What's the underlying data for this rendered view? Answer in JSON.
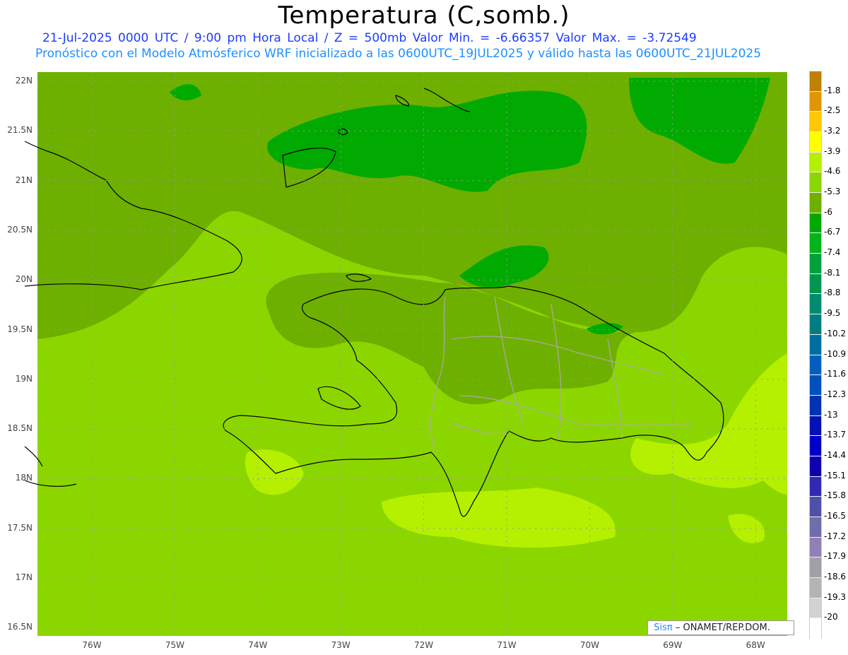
{
  "title": "Temperatura (C,somb.)",
  "subtitle1": "21-Jul-2025   0000 UTC / 9:00 pm Hora Local / Z = 500mb  Valor Min. = -6.66357  Valor Max. = -3.72549",
  "subtitle2": "Pronóstico con el Modelo Atmósferico WRF inicializado a las 0600UTC_19JUL2025 y válido hasta las  0600UTC_21JUL2025",
  "lat_labels": [
    "22N",
    "21.5N",
    "21N",
    "20.5N",
    "20N",
    "19.5N",
    "19N",
    "18.5N",
    "18N",
    "17.5N",
    "17N",
    "16.5N"
  ],
  "lon_labels": [
    "76W",
    "75W",
    "74W",
    "73W",
    "72W",
    "71W",
    "70W",
    "69W",
    "68W"
  ],
  "colorbar": {
    "labels": [
      "-1.8",
      "-2.5",
      "-3.2",
      "-3.9",
      "-4.6",
      "-5.3",
      "-6",
      "-6.7",
      "-7.4",
      "-8.1",
      "-8.8",
      "-9.5",
      "-10.2",
      "-10.9",
      "-11.6",
      "-12.3",
      "-13",
      "-13.7",
      "-14.4",
      "-15.1",
      "-15.8",
      "-16.5",
      "-17.2",
      "-17.9",
      "-18.6",
      "-19.3",
      "-20"
    ],
    "colors": [
      "#c08000",
      "#e09600",
      "#ffc800",
      "#ffff00",
      "#b4f000",
      "#8cd600",
      "#6eb000",
      "#00aa00",
      "#00b41e",
      "#00a03c",
      "#009650",
      "#008c6e",
      "#007f82",
      "#006ea0",
      "#0060bc",
      "#0050c0",
      "#0032b4",
      "#0014b4",
      "#0000c8",
      "#1000b4",
      "#3228b4",
      "#5050aa",
      "#6e6eaa",
      "#9080b4",
      "#a0a0aa",
      "#b4b4b4",
      "#d2d2d2",
      "#ffffff"
    ]
  },
  "credit": {
    "brand": "Sisπ",
    "text": " – ONAMET/REP.DOM."
  }
}
